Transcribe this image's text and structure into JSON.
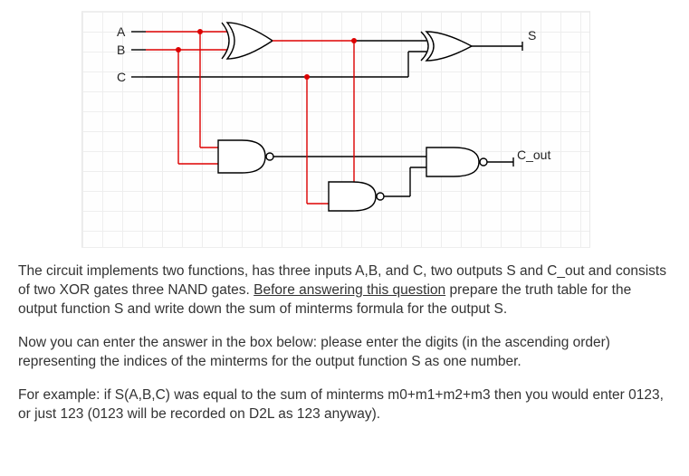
{
  "circuit": {
    "inputs": {
      "A": "A",
      "B": "B",
      "C": "C"
    },
    "outputs": {
      "S": "S",
      "Cout": "C_out"
    }
  },
  "text": {
    "p1a": "The circuit implements two functions, has three inputs A,B, and C, two outputs S and C_out and consists of two XOR gates three NAND gates. ",
    "p1u": "Before answering this question",
    "p1b": " prepare the truth table for the output function S and write down the sum of minterms formula for the output S.",
    "p2": "Now you can enter the answer in the box below: please enter the digits (in the ascending order) representing the indices of the minterms for the output function S as one number.",
    "p3": "For example: if S(A,B,C) was equal to the sum of minterms m0+m1+m2+m3 then you would enter 0123, or just 123 (0123 will be recorded on D2L as 123 anyway)."
  }
}
